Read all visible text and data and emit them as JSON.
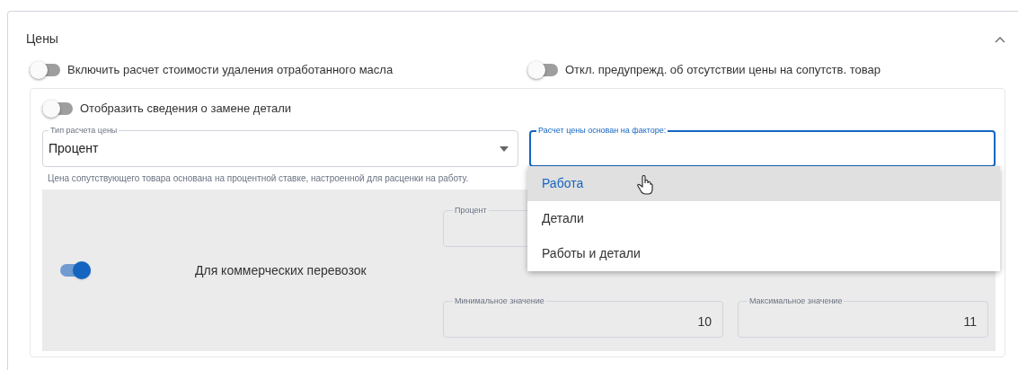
{
  "section": {
    "title": "Цены",
    "expanded": true
  },
  "toggles": [
    {
      "label": "Включить расчет стоимости удаления отработанного масла",
      "on": false
    },
    {
      "label": "Откл. предупрежд. об отсутствии цены на сопутств. товар",
      "on": false
    }
  ],
  "part_card": {
    "toggle": {
      "label": "Отобразить сведения о замене детали",
      "on": false
    },
    "price_type_field": {
      "label": "Тип расчета цены",
      "value": "Процент"
    },
    "factor_field": {
      "label": "Расчет цены основан на факторе:",
      "focused": true
    },
    "helper_text": "Цена сопутствующего товара основана на процентной ставке, настроенной для расценки на работу.",
    "commercial": {
      "toggle": {
        "label": "Для коммерческих перевозок",
        "on": true
      },
      "fields": [
        {
          "label": "Процент"
        },
        {
          "label": "Минимальное значение",
          "value": "10"
        },
        {
          "label": "Максимальное значение",
          "value": "11"
        }
      ]
    }
  },
  "dropdown_menu": [
    {
      "label": "Работа",
      "selected": true
    },
    {
      "label": "Детали",
      "selected": false
    },
    {
      "label": "Работы и детали",
      "selected": false
    }
  ]
}
